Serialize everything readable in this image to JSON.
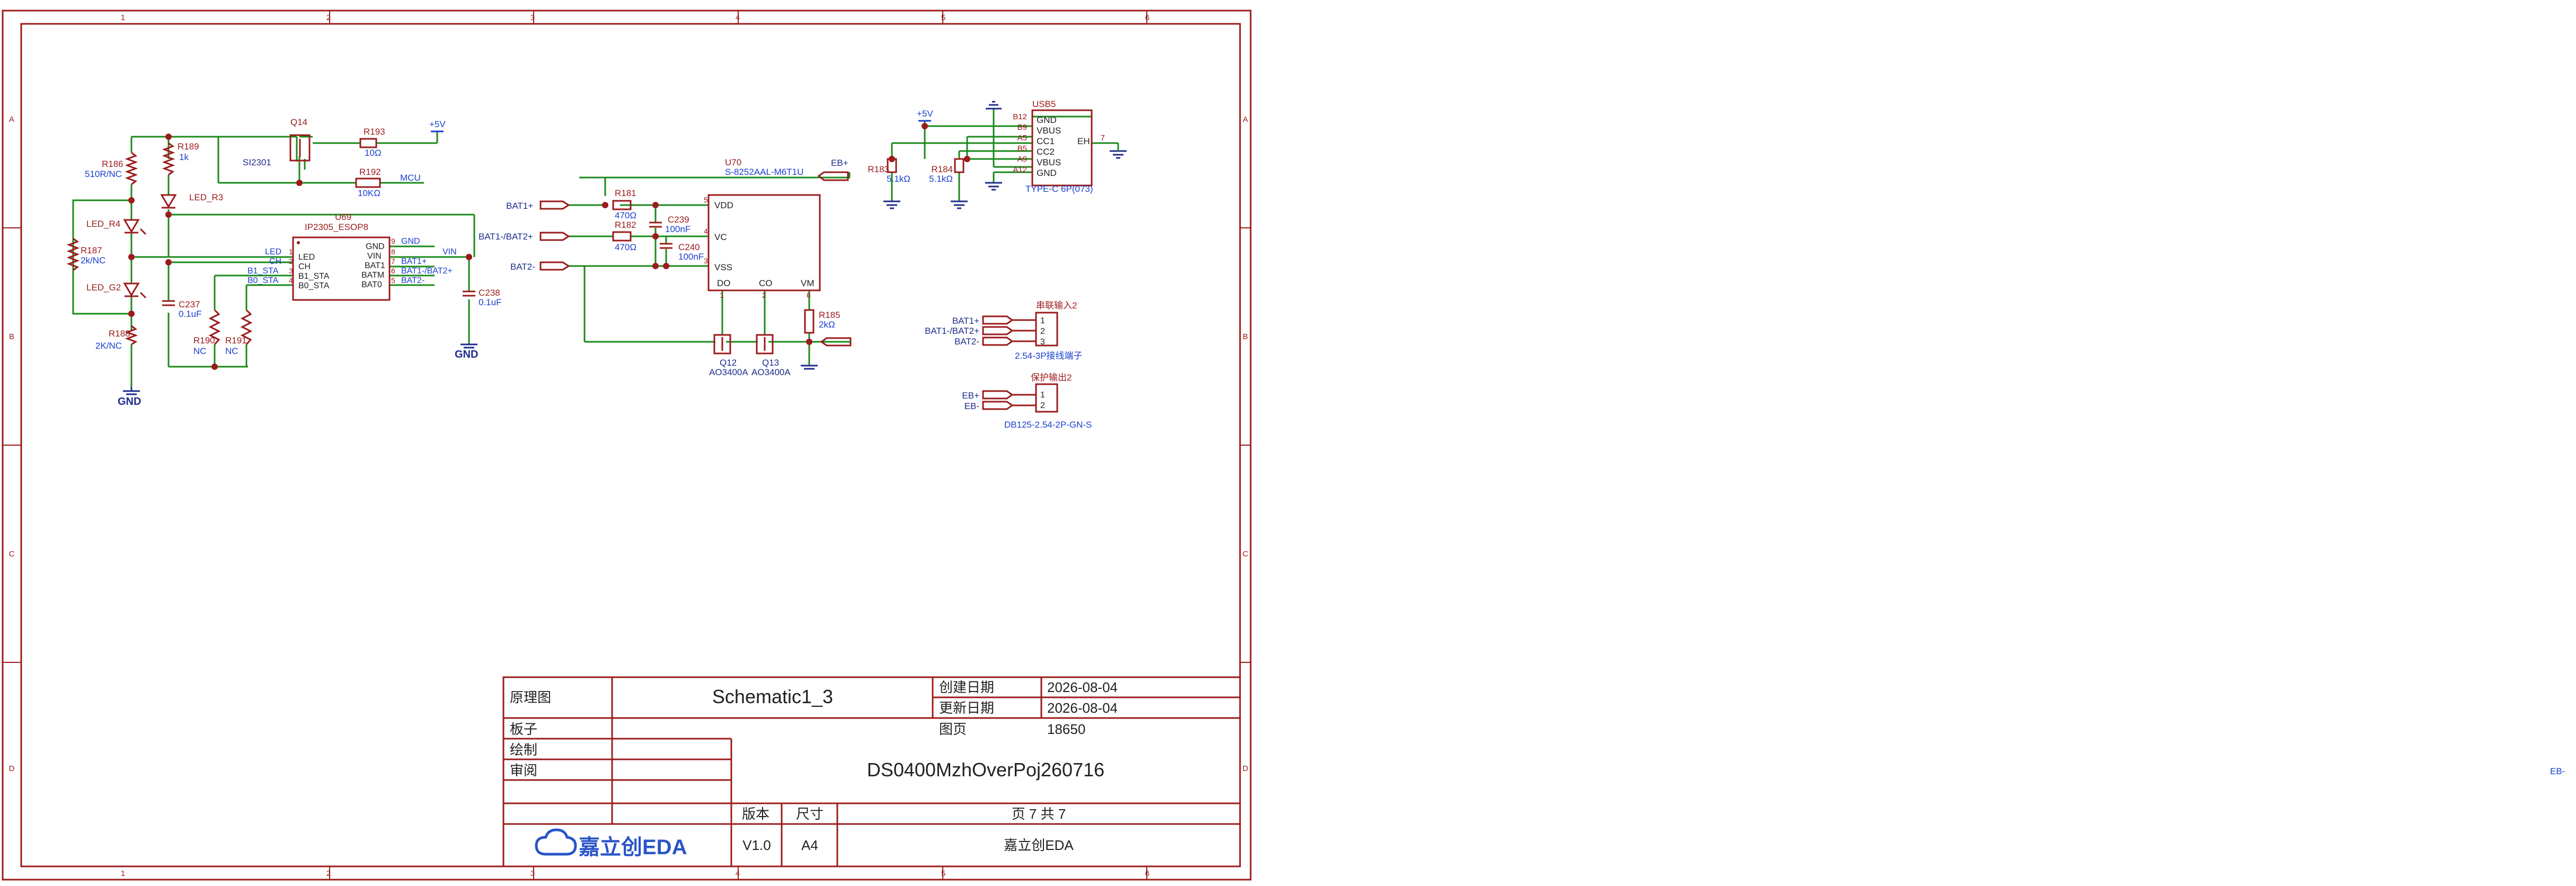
{
  "sheet": {
    "col_labels": [
      "1",
      "2",
      "3",
      "4",
      "5",
      "6"
    ],
    "row_labels": [
      "A",
      "B",
      "C",
      "D"
    ]
  },
  "title_block": {
    "type_label": "原理图",
    "schematic_name": "Schematic1_3",
    "create_date_label": "创建日期",
    "create_date": "2026-08-04",
    "update_date_label": "更新日期",
    "update_date": "2026-08-04",
    "page_count_label": "图页",
    "page_count": "18650",
    "board_label": "板子",
    "drawn_label": "绘制",
    "review_label": "审阅",
    "project_name": "DS0400MzhOverPoj260716",
    "version_label": "版本",
    "size_label": "尺寸",
    "page_info": "页 7 共 7",
    "version": "V1.0",
    "size": "A4",
    "company": "嘉立创EDA",
    "logo_text": "嘉立创EDA"
  },
  "stray_label": "EB-",
  "colors": {
    "wire": "#1a8a1a",
    "part": "#9b1b1b",
    "net": "#1a3fd0",
    "ground": "#1e2c8c"
  },
  "schematic": {
    "r186": {
      "ref": "R186",
      "value": "510R/NC"
    },
    "r189": {
      "ref": "R189",
      "value": "1k"
    },
    "q14": {
      "ref": "Q14",
      "value": "SI2301"
    },
    "r193": {
      "ref": "R193",
      "value": "10Ω"
    },
    "r192": {
      "ref": "R192",
      "value": "10KΩ"
    },
    "net_5v": "+5V",
    "net_mcu": "MCU",
    "led_r3": "LED_R3",
    "led_r4": "LED_R4",
    "led_g2": "LED_G2",
    "r187": {
      "ref": "R187",
      "value": "2k/NC"
    },
    "r188": {
      "ref": "R188",
      "value": "2K/NC"
    },
    "gnd": "GND",
    "u69": {
      "ref": "U69",
      "value": "IP2305_ESOP8",
      "left_pins": [
        "LED",
        "CH",
        "B1_STA",
        "B0_STA"
      ],
      "left_nets": [
        "LED",
        "CH",
        "B1_STA",
        "B0_STA"
      ],
      "left_nums": [
        "1",
        "2",
        "3",
        "4"
      ],
      "right_pins": [
        "GND",
        "VIN",
        "BAT1",
        "BATM",
        "BAT0"
      ],
      "right_nums": [
        "9",
        "8",
        "7",
        "6",
        "5"
      ],
      "right_nets": [
        "GND",
        "VIN",
        "BAT1+",
        "BAT1-/BAT2+",
        "BAT2-"
      ]
    },
    "c237": {
      "ref": "C237",
      "value": "0.1uF"
    },
    "c238": {
      "ref": "C238",
      "value": "0.1uF"
    },
    "r190": {
      "ref": "R190",
      "value": "NC"
    },
    "r191": {
      "ref": "R191",
      "value": "NC"
    },
    "u70": {
      "ref": "U70",
      "value": "S-8252AAL-M6T1U",
      "pins": [
        "VDD",
        "VC",
        "VSS",
        "DO",
        "CO",
        "VM"
      ],
      "pin_nums": [
        "5",
        "4",
        "3",
        "1",
        "2",
        "6"
      ]
    },
    "net_eb_plus": "EB+",
    "net_bat1p": "BAT1+",
    "net_bat12": "BAT1-/BAT2+",
    "net_bat2m": "BAT2-",
    "r181": {
      "ref": "R181",
      "value": "470Ω"
    },
    "r182": {
      "ref": "R182",
      "value": "470Ω"
    },
    "c239": {
      "ref": "C239",
      "value": "100nF"
    },
    "c240": {
      "ref": "C240",
      "value": "100nF"
    },
    "r185": {
      "ref": "R185",
      "value": "2kΩ"
    },
    "q12": {
      "ref": "Q12",
      "value": "AO3400A"
    },
    "q13": {
      "ref": "Q13",
      "value": "AO3400A"
    },
    "usb5": {
      "ref": "USB5",
      "value": "TYPE-C 6P(073)",
      "pins": [
        "GND",
        "VBUS",
        "CC1",
        "CC2",
        "VBUS",
        "GND"
      ],
      "pin_nums": [
        "B12",
        "B9",
        "A5",
        "B5",
        "A9",
        "A12"
      ],
      "eh_label": "EH",
      "eh_num": "7"
    },
    "r183": {
      "ref": "R183",
      "value": "5.1kΩ"
    },
    "r184": {
      "ref": "R184",
      "value": "5.1kΩ"
    },
    "conn_in": {
      "title": "串联输入2",
      "nets": [
        "BAT1+",
        "BAT1-/BAT2+",
        "BAT2-"
      ],
      "pins": [
        "1",
        "2",
        "3"
      ],
      "footprint": "2.54-3P接线端子"
    },
    "conn_out": {
      "title": "保护输出2",
      "nets": [
        "EB+",
        "EB-"
      ],
      "pins": [
        "1",
        "2"
      ],
      "footprint": "DB125-2.54-2P-GN-S"
    }
  }
}
